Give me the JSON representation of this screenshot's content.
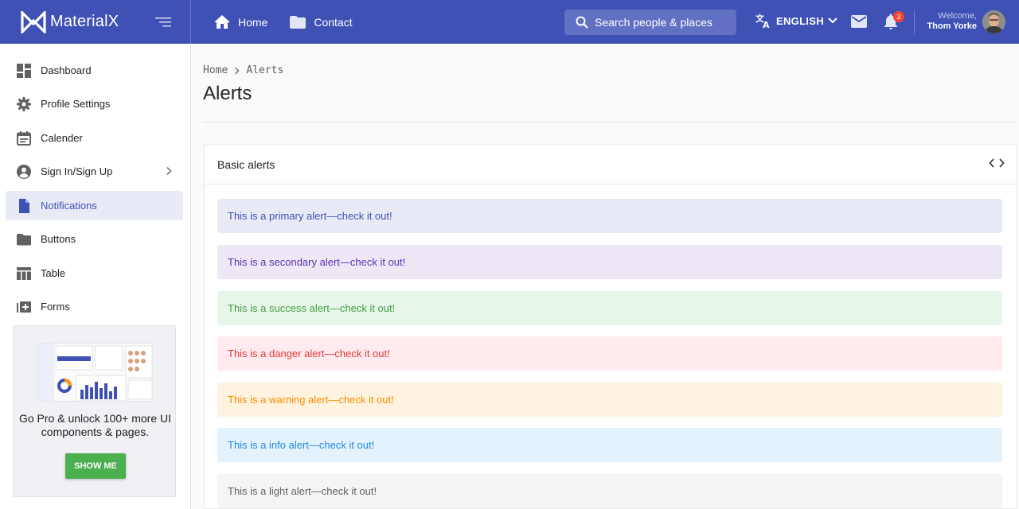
{
  "brand": {
    "name": "MaterialX"
  },
  "topnav": [
    {
      "label": "Home",
      "icon": "home-icon"
    },
    {
      "label": "Contact",
      "icon": "folder-icon"
    }
  ],
  "search": {
    "placeholder": "Search people & places"
  },
  "language": {
    "label": "ENGLISH"
  },
  "notifications": {
    "count": "3"
  },
  "user": {
    "welcome": "Welcome,",
    "name": "Thom Yorke"
  },
  "sidebar": {
    "items": [
      {
        "label": "Dashboard",
        "icon": "dashboard-icon"
      },
      {
        "label": "Profile Settings",
        "icon": "gear-icon"
      },
      {
        "label": "Calender",
        "icon": "calendar-icon"
      },
      {
        "label": "Sign In/Sign Up",
        "icon": "account-circle-icon",
        "has_submenu": true
      },
      {
        "label": "Notifications",
        "icon": "file-icon",
        "active": true
      },
      {
        "label": "Buttons",
        "icon": "folder-icon"
      },
      {
        "label": "Table",
        "icon": "table-icon"
      },
      {
        "label": "Forms",
        "icon": "add-box-icon"
      }
    ],
    "promo": {
      "text": "Go Pro & unlock 100+ more UI components & pages.",
      "button": "SHOW ME"
    }
  },
  "breadcrumb": [
    "Home",
    "Alerts"
  ],
  "page": {
    "title": "Alerts"
  },
  "card": {
    "title": "Basic alerts",
    "alerts": [
      {
        "type": "primary",
        "text": "This is a primary alert—check it out!",
        "bg": "#e8eaf6",
        "color": "#3f51b5"
      },
      {
        "type": "secondary",
        "text": "This is a secondary alert—check it out!",
        "bg": "#ede7f6",
        "color": "#5e35b1"
      },
      {
        "type": "success",
        "text": "This is a success alert—check it out!",
        "bg": "#e8f5e9",
        "color": "#43a047"
      },
      {
        "type": "danger",
        "text": "This is a danger alert—check it out!",
        "bg": "#ffebee",
        "color": "#e53935"
      },
      {
        "type": "warning",
        "text": "This is a warning alert—check it out!",
        "bg": "#fff3e0",
        "color": "#fb8c00"
      },
      {
        "type": "info",
        "text": "This is a info alert—check it out!",
        "bg": "#e3f2fd",
        "color": "#1e88e5"
      },
      {
        "type": "light",
        "text": "This is a light alert—check it out!",
        "bg": "#f5f5f5",
        "color": "#616161"
      }
    ]
  },
  "colors": {
    "primary": "#3f51b5",
    "success": "#4caf50",
    "danger": "#f44336"
  }
}
